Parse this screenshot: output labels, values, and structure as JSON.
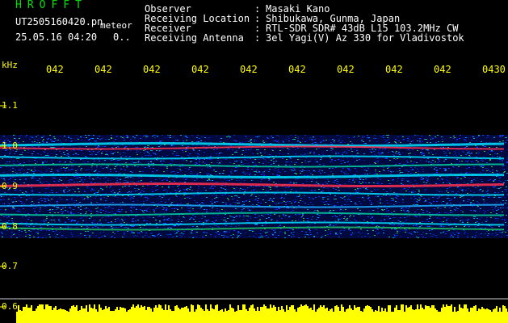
{
  "header": {
    "app_title": "HROFFT",
    "filename": "UT2505160420.pn",
    "tag": "meteor",
    "datetime": "25.05.16 04:20",
    "dots": "0..",
    "info": [
      {
        "label": "Observer",
        "sep": ":",
        "value": "Masaki Kano"
      },
      {
        "label": "Receiving Location",
        "sep": ":",
        "value": "Shibukawa, Gunma, Japan"
      },
      {
        "label": "Receiver",
        "sep": ":",
        "value": "RTL-SDR SDR# 43dB L15 103.2MHz CW"
      },
      {
        "label": "Receiving Antenna",
        "sep": ":",
        "value": "3el Yagi(V) Az 330 for Vladivostok"
      }
    ]
  },
  "axis": {
    "unit_label": "kHz",
    "time_ticks": [
      "042",
      "042",
      "042",
      "042",
      "042",
      "042",
      "042",
      "042",
      "042",
      "0430"
    ],
    "freq_ticks": [
      "1.1",
      "1.0",
      "0.9",
      "0.8",
      "0.7",
      "0.6"
    ]
  },
  "colors": {
    "background": "#000000",
    "label_yellow": "#ffff00",
    "title_green": "#00e000",
    "spectrum_blue": "#0020c0",
    "signal_red": "#ff3050",
    "signal_cyan": "#00e0ff",
    "power_bar": "#ffff00"
  }
}
